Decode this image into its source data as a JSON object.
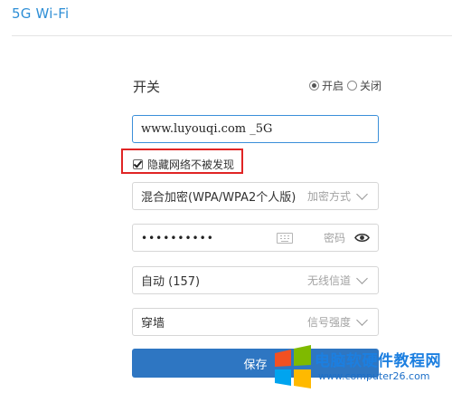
{
  "header": {
    "title": "5G Wi-Fi"
  },
  "switch": {
    "label": "开关",
    "options": [
      {
        "label": "开启",
        "selected": true
      },
      {
        "label": "关闭",
        "selected": false
      }
    ]
  },
  "ssid": {
    "value": "www.luyouqi.com _5G"
  },
  "hide_network": {
    "label": "隐藏网络不被发现",
    "checked": true
  },
  "encryption": {
    "value": "混合加密(WPA/WPA2个人版)",
    "hint": "加密方式"
  },
  "password": {
    "masked_value": "••••••••••",
    "hint": "密码"
  },
  "channel": {
    "value": "自动 (157)",
    "hint": "无线信道"
  },
  "signal": {
    "value": "穿墙",
    "hint": "信号强度"
  },
  "save": {
    "label": "保存"
  },
  "watermark": {
    "title": "电脑软硬件教程网",
    "url": "www.computer26.com"
  },
  "colors": {
    "accent": "#2f8fd6",
    "button": "#2e76c2",
    "highlight": "#e02525"
  }
}
